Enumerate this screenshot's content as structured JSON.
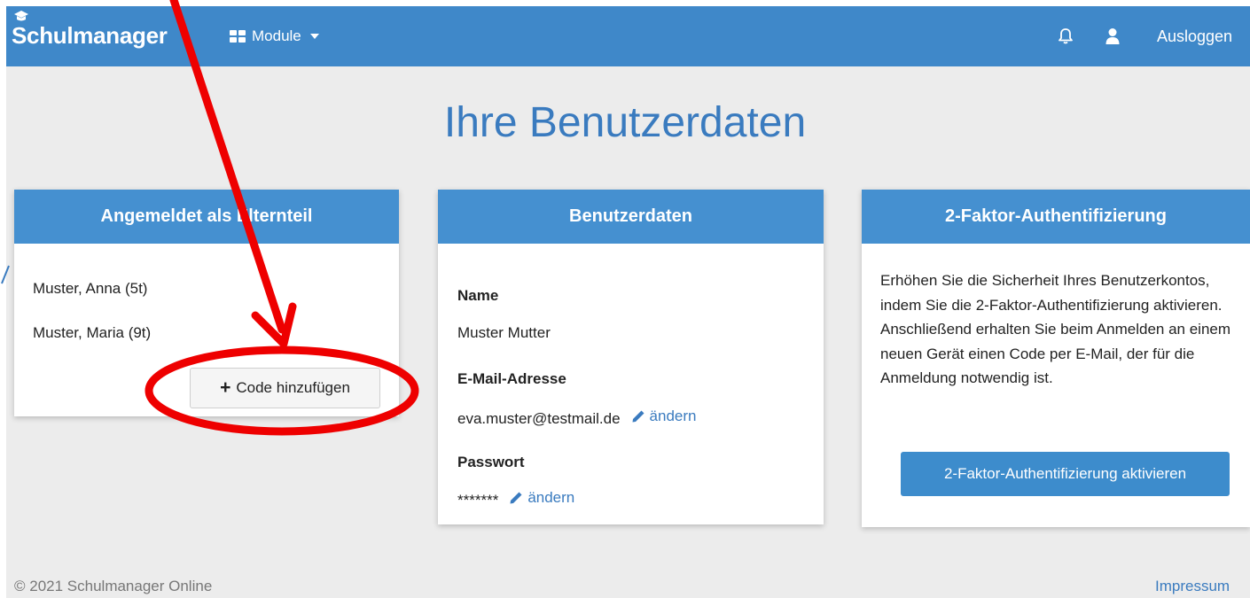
{
  "navbar": {
    "brand": "Schulmanager",
    "modules_label": "Module",
    "logout_label": "Ausloggen"
  },
  "page": {
    "title": "Ihre Benutzerdaten"
  },
  "parent_card": {
    "header": "Angemeldet als Elternteil",
    "children": [
      "Muster, Anna (5t)",
      "Muster, Maria (9t)"
    ],
    "add_code_label": "Code hinzufügen"
  },
  "user_card": {
    "header": "Benutzerdaten",
    "name_label": "Name",
    "name_value": "Muster Mutter",
    "email_label": "E-Mail-Adresse",
    "email_value": "eva.muster@testmail.de",
    "email_edit": "ändern",
    "password_label": "Passwort",
    "password_value": "*******",
    "password_edit": "ändern"
  },
  "tfa_card": {
    "header": "2-Faktor-Authentifizierung",
    "text": "Erhöhen Sie die Sicherheit Ihres Benutzerkontos, indem Sie die 2-Faktor-Authentifizierung aktivieren. Anschließend erhalten Sie beim Anmelden an einem neuen Gerät einen Code per E-Mail, der für die Anmeldung notwendig ist.",
    "button_label": "2-Faktor-Authentifizierung aktivieren"
  },
  "footer": {
    "copyright": "© 2021 Schulmanager Online",
    "imprint": "Impressum"
  },
  "colors": {
    "navbar": "#3f88c9",
    "card_header": "#4590d0",
    "title": "#3a7bbf",
    "annotation": "#ee0000"
  },
  "icons": [
    "graduation-cap-icon",
    "grid-icon",
    "bell-icon",
    "user-icon",
    "plus-icon",
    "pencil-icon"
  ]
}
